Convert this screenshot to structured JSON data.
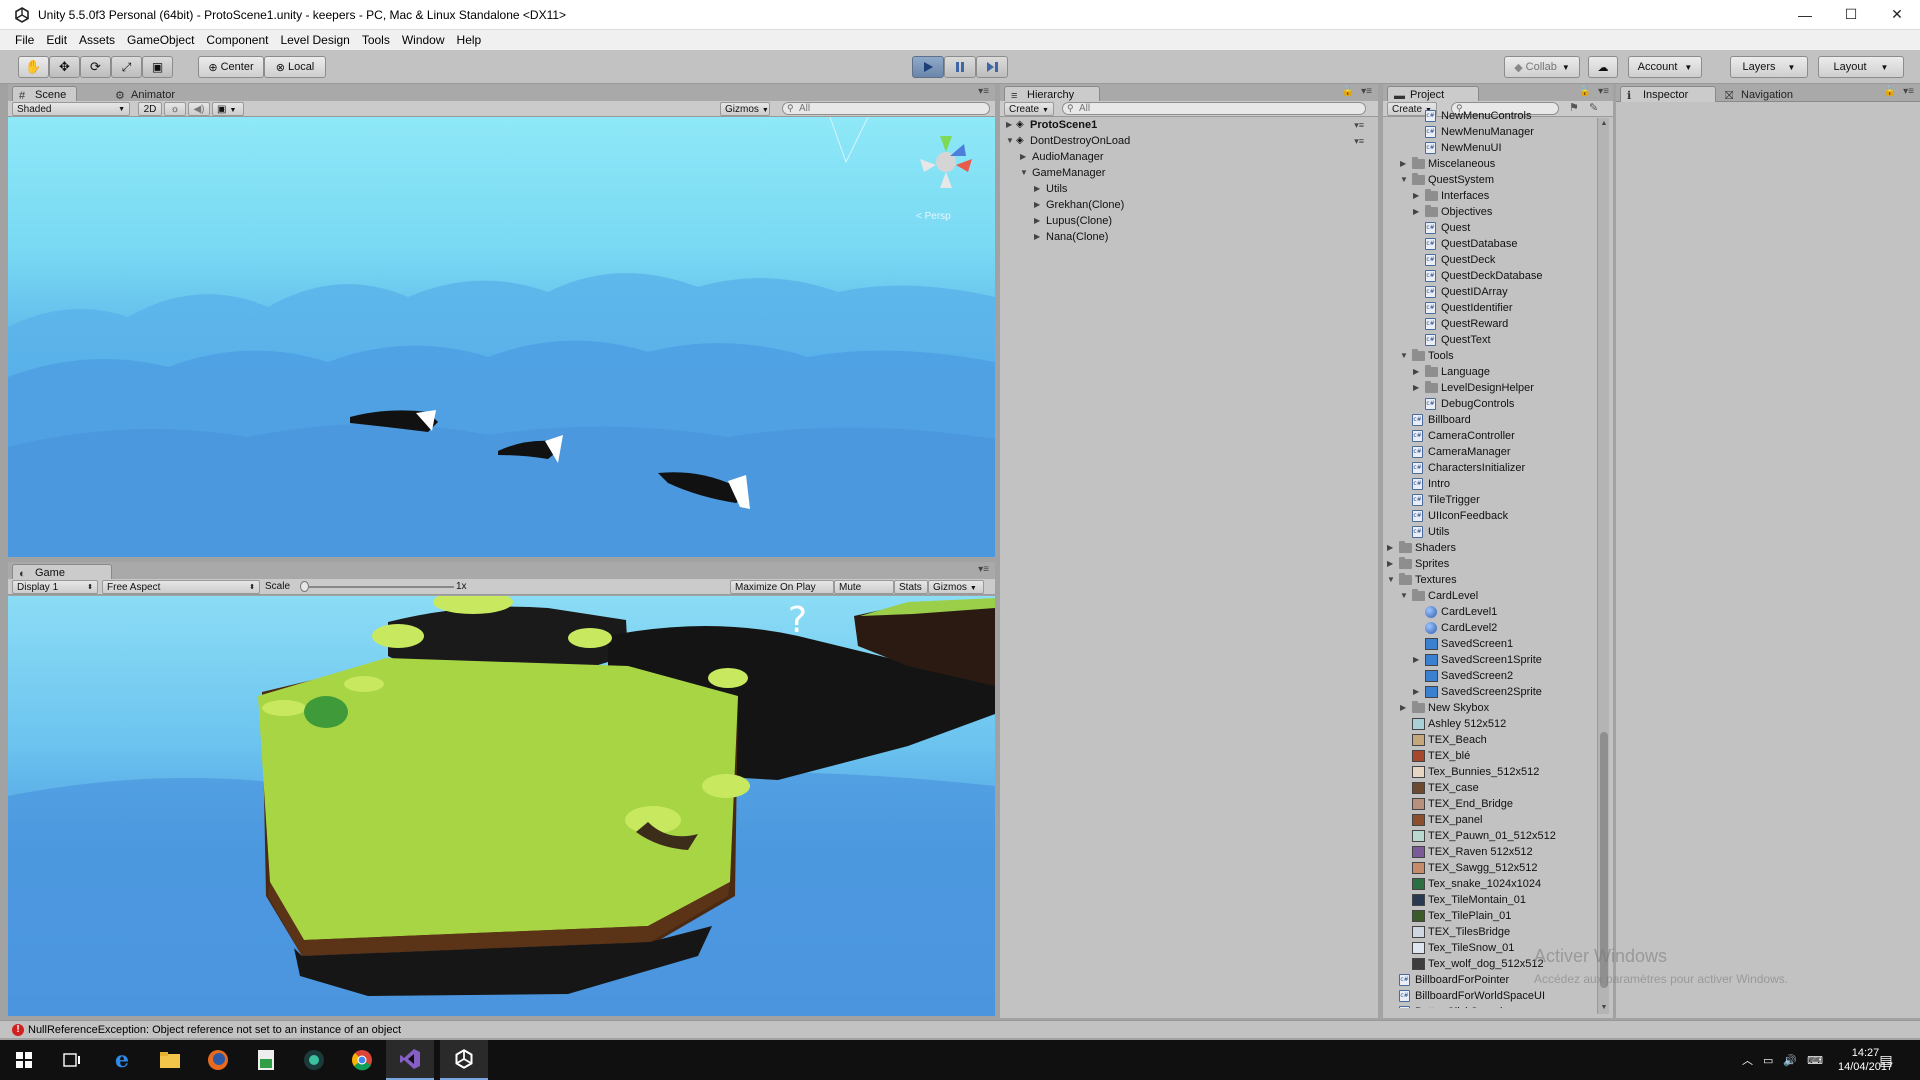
{
  "window": {
    "title": "Unity 5.5.0f3 Personal (64bit) - ProtoScene1.unity - keepers - PC, Mac & Linux Standalone <DX11>",
    "minimize": "—",
    "maximize": "☐",
    "close": "✕"
  },
  "menu": [
    "File",
    "Edit",
    "Assets",
    "GameObject",
    "Component",
    "Level Design",
    "Tools",
    "Window",
    "Help"
  ],
  "toolbar": {
    "pivot": "Center",
    "space": "Local",
    "collab": "Collab",
    "account": "Account",
    "layers": "Layers",
    "layout": "Layout"
  },
  "scene_panel": {
    "tab_scene": "Scene",
    "tab_animator": "Animator",
    "shading": "Shaded",
    "mode2d": "2D",
    "gizmos": "Gizmos",
    "search_placeholder": "All",
    "persp_label": "< Persp"
  },
  "game_panel": {
    "tab": "Game",
    "display": "Display 1",
    "aspect": "Free Aspect",
    "scale_label": "Scale",
    "scale_value": "1x",
    "maximize": "Maximize On Play",
    "mute": "Mute Audio",
    "stats": "Stats",
    "gizmos": "Gizmos"
  },
  "hierarchy": {
    "tab": "Hierarchy",
    "create": "Create",
    "search_placeholder": "All",
    "items": [
      {
        "label": "ProtoScene1",
        "level": 0,
        "arrow": "▶",
        "bold": true,
        "scene": true
      },
      {
        "label": "DontDestroyOnLoad",
        "level": 0,
        "arrow": "▼",
        "bold": false,
        "scene": true
      },
      {
        "label": "AudioManager",
        "level": 1,
        "arrow": "▶",
        "bold": false,
        "scene": false
      },
      {
        "label": "GameManager",
        "level": 1,
        "arrow": "▼",
        "bold": false,
        "scene": false
      },
      {
        "label": "Utils",
        "level": 2,
        "arrow": "▶",
        "bold": false,
        "scene": false
      },
      {
        "label": "Grekhan(Clone)",
        "level": 2,
        "arrow": "▶",
        "bold": false,
        "scene": false
      },
      {
        "label": "Lupus(Clone)",
        "level": 2,
        "arrow": "▶",
        "bold": false,
        "scene": false
      },
      {
        "label": "Nana(Clone)",
        "level": 2,
        "arrow": "▶",
        "bold": false,
        "scene": false
      }
    ]
  },
  "project": {
    "tab": "Project",
    "create": "Create",
    "items": [
      {
        "label": "NewMenuControls",
        "indent": 3,
        "type": "script",
        "arrow": ""
      },
      {
        "label": "NewMenuManager",
        "indent": 3,
        "type": "script",
        "arrow": ""
      },
      {
        "label": "NewMenuUI",
        "indent": 3,
        "type": "script",
        "arrow": ""
      },
      {
        "label": "Miscelaneous",
        "indent": 2,
        "type": "folder",
        "arrow": "▶"
      },
      {
        "label": "QuestSystem",
        "indent": 2,
        "type": "folder",
        "arrow": "▼"
      },
      {
        "label": "Interfaces",
        "indent": 3,
        "type": "folder",
        "arrow": "▶"
      },
      {
        "label": "Objectives",
        "indent": 3,
        "type": "folder",
        "arrow": "▶"
      },
      {
        "label": "Quest",
        "indent": 3,
        "type": "script",
        "arrow": ""
      },
      {
        "label": "QuestDatabase",
        "indent": 3,
        "type": "script",
        "arrow": ""
      },
      {
        "label": "QuestDeck",
        "indent": 3,
        "type": "script",
        "arrow": ""
      },
      {
        "label": "QuestDeckDatabase",
        "indent": 3,
        "type": "script",
        "arrow": ""
      },
      {
        "label": "QuestIDArray",
        "indent": 3,
        "type": "script",
        "arrow": ""
      },
      {
        "label": "QuestIdentifier",
        "indent": 3,
        "type": "script",
        "arrow": ""
      },
      {
        "label": "QuestReward",
        "indent": 3,
        "type": "script",
        "arrow": ""
      },
      {
        "label": "QuestText",
        "indent": 3,
        "type": "script",
        "arrow": ""
      },
      {
        "label": "Tools",
        "indent": 2,
        "type": "folder",
        "arrow": "▼"
      },
      {
        "label": "Language",
        "indent": 3,
        "type": "folder",
        "arrow": "▶"
      },
      {
        "label": "LevelDesignHelper",
        "indent": 3,
        "type": "folder",
        "arrow": "▶"
      },
      {
        "label": "DebugControls",
        "indent": 3,
        "type": "script",
        "arrow": ""
      },
      {
        "label": "Billboard",
        "indent": 2,
        "type": "script",
        "arrow": ""
      },
      {
        "label": "CameraController",
        "indent": 2,
        "type": "script",
        "arrow": ""
      },
      {
        "label": "CameraManager",
        "indent": 2,
        "type": "script",
        "arrow": ""
      },
      {
        "label": "CharactersInitializer",
        "indent": 2,
        "type": "script",
        "arrow": ""
      },
      {
        "label": "Intro",
        "indent": 2,
        "type": "script",
        "arrow": ""
      },
      {
        "label": "TileTrigger",
        "indent": 2,
        "type": "script",
        "arrow": ""
      },
      {
        "label": "UIIconFeedback",
        "indent": 2,
        "type": "script",
        "arrow": ""
      },
      {
        "label": "Utils",
        "indent": 2,
        "type": "script",
        "arrow": ""
      },
      {
        "label": "Shaders",
        "indent": 1,
        "type": "folder",
        "arrow": "▶"
      },
      {
        "label": "Sprites",
        "indent": 1,
        "type": "folder",
        "arrow": "▶"
      },
      {
        "label": "Textures",
        "indent": 1,
        "type": "folder",
        "arrow": "▼"
      },
      {
        "label": "CardLevel",
        "indent": 2,
        "type": "folder",
        "arrow": "▼"
      },
      {
        "label": "CardLevel1",
        "indent": 3,
        "type": "sphere",
        "arrow": ""
      },
      {
        "label": "CardLevel2",
        "indent": 3,
        "type": "sphere",
        "arrow": ""
      },
      {
        "label": "SavedScreen1",
        "indent": 3,
        "type": "texture",
        "arrow": "",
        "color": "#3a7fd0"
      },
      {
        "label": "SavedScreen1Sprite",
        "indent": 3,
        "type": "texture",
        "arrow": "▶",
        "color": "#3a7fd0"
      },
      {
        "label": "SavedScreen2",
        "indent": 3,
        "type": "texture",
        "arrow": "",
        "color": "#3a7fd0"
      },
      {
        "label": "SavedScreen2Sprite",
        "indent": 3,
        "type": "texture",
        "arrow": "▶",
        "color": "#3a7fd0"
      },
      {
        "label": "New Skybox",
        "indent": 2,
        "type": "folder",
        "arrow": "▶"
      },
      {
        "label": "Ashley 512x512",
        "indent": 2,
        "type": "texture",
        "arrow": "",
        "color": "#a9cfd7"
      },
      {
        "label": "TEX_Beach",
        "indent": 2,
        "type": "texture",
        "arrow": "",
        "color": "#c4a77a"
      },
      {
        "label": "TEX_blé",
        "indent": 2,
        "type": "texture",
        "arrow": "",
        "color": "#a5482f"
      },
      {
        "label": "Tex_Bunnies_512x512",
        "indent": 2,
        "type": "texture",
        "arrow": "",
        "color": "#e6d7c5"
      },
      {
        "label": "TEX_case",
        "indent": 2,
        "type": "texture",
        "arrow": "",
        "color": "#6b4a2f"
      },
      {
        "label": "TEX_End_Bridge",
        "indent": 2,
        "type": "texture",
        "arrow": "",
        "color": "#b7917d"
      },
      {
        "label": "TEX_panel",
        "indent": 2,
        "type": "texture",
        "arrow": "",
        "color": "#8c4f2d"
      },
      {
        "label": "TEX_Pauwn_01_512x512",
        "indent": 2,
        "type": "texture",
        "arrow": "",
        "color": "#b9d8d0"
      },
      {
        "label": "TEX_Raven 512x512",
        "indent": 2,
        "type": "texture",
        "arrow": "",
        "color": "#7b5a98"
      },
      {
        "label": "TEX_Sawgg_512x512",
        "indent": 2,
        "type": "texture",
        "arrow": "",
        "color": "#c58b6a"
      },
      {
        "label": "Tex_snake_1024x1024",
        "indent": 2,
        "type": "texture",
        "arrow": "",
        "color": "#2b6f43"
      },
      {
        "label": "Tex_TileMontain_01",
        "indent": 2,
        "type": "texture",
        "arrow": "",
        "color": "#2a3950"
      },
      {
        "label": "Tex_TilePlain_01",
        "indent": 2,
        "type": "texture",
        "arrow": "",
        "color": "#3a5c2a"
      },
      {
        "label": "TEX_TilesBridge",
        "indent": 2,
        "type": "texture",
        "arrow": "",
        "color": "#cfd8e0"
      },
      {
        "label": "Tex_TileSnow_01",
        "indent": 2,
        "type": "texture",
        "arrow": "",
        "color": "#dde5f0"
      },
      {
        "label": "Tex_wolf_dog_512x512",
        "indent": 2,
        "type": "texture",
        "arrow": "",
        "color": "#3d3d3d"
      },
      {
        "label": "BillboardForPointer",
        "indent": 1,
        "type": "script",
        "arrow": ""
      },
      {
        "label": "BillboardForWorldSpaceUI",
        "indent": 1,
        "type": "script",
        "arrow": ""
      },
      {
        "label": "ButtonClickSound",
        "indent": 1,
        "type": "script",
        "arrow": ""
      }
    ]
  },
  "inspector": {
    "tab": "Inspector",
    "nav_tab": "Navigation"
  },
  "status": {
    "message": "NullReferenceException: Object reference not set to an instance of an object"
  },
  "watermark": {
    "line1": "Activer Windows",
    "line2": "Accédez aux paramètres pour activer Windows."
  },
  "taskbar": {
    "time": "14:27",
    "date": "14/04/2017"
  },
  "colors": {
    "accent_play": "#4d78b5",
    "error": "#d02020",
    "panel_bg": "#c2c2c2"
  }
}
